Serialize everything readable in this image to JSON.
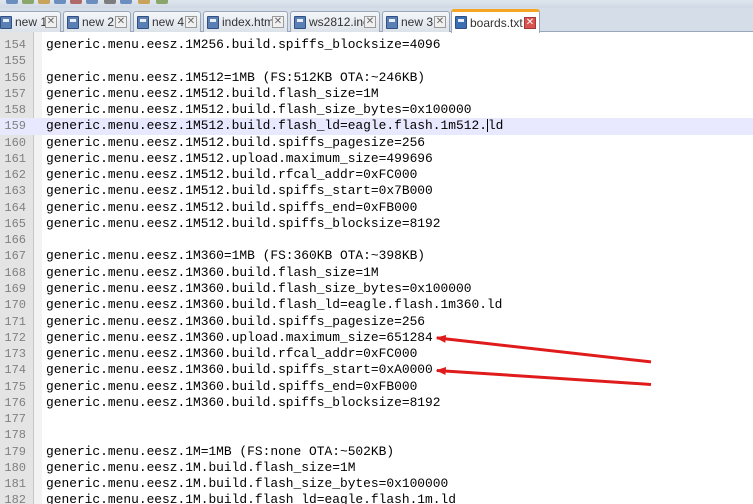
{
  "tabs": [
    {
      "label": "new 1",
      "active": false
    },
    {
      "label": "new 2",
      "active": false
    },
    {
      "label": "new 4",
      "active": false
    },
    {
      "label": "index.html",
      "active": false
    },
    {
      "label": "ws2812.ino",
      "active": false
    },
    {
      "label": "new 3",
      "active": false
    },
    {
      "label": "boards.txt",
      "active": true
    }
  ],
  "editor": {
    "current_line": "159",
    "lines": [
      {
        "num": "154",
        "text": "generic.menu.eesz.1M256.build.spiffs_blocksize=4096"
      },
      {
        "num": "155",
        "text": ""
      },
      {
        "num": "156",
        "text": "generic.menu.eesz.1M512=1MB (FS:512KB OTA:~246KB)"
      },
      {
        "num": "157",
        "text": "generic.menu.eesz.1M512.build.flash_size=1M"
      },
      {
        "num": "158",
        "text": "generic.menu.eesz.1M512.build.flash_size_bytes=0x100000"
      },
      {
        "num": "159",
        "text": "generic.menu.eesz.1M512.build.flash_ld=eagle.flash.1m512.ld"
      },
      {
        "num": "160",
        "text": "generic.menu.eesz.1M512.build.spiffs_pagesize=256"
      },
      {
        "num": "161",
        "text": "generic.menu.eesz.1M512.upload.maximum_size=499696"
      },
      {
        "num": "162",
        "text": "generic.menu.eesz.1M512.build.rfcal_addr=0xFC000"
      },
      {
        "num": "163",
        "text": "generic.menu.eesz.1M512.build.spiffs_start=0x7B000"
      },
      {
        "num": "164",
        "text": "generic.menu.eesz.1M512.build.spiffs_end=0xFB000"
      },
      {
        "num": "165",
        "text": "generic.menu.eesz.1M512.build.spiffs_blocksize=8192"
      },
      {
        "num": "166",
        "text": ""
      },
      {
        "num": "167",
        "text": "generic.menu.eesz.1M360=1MB (FS:360KB OTA:~398KB)"
      },
      {
        "num": "168",
        "text": "generic.menu.eesz.1M360.build.flash_size=1M"
      },
      {
        "num": "169",
        "text": "generic.menu.eesz.1M360.build.flash_size_bytes=0x100000"
      },
      {
        "num": "170",
        "text": "generic.menu.eesz.1M360.build.flash_ld=eagle.flash.1m360.ld"
      },
      {
        "num": "171",
        "text": "generic.menu.eesz.1M360.build.spiffs_pagesize=256"
      },
      {
        "num": "172",
        "text": "generic.menu.eesz.1M360.upload.maximum_size=651284"
      },
      {
        "num": "173",
        "text": "generic.menu.eesz.1M360.build.rfcal_addr=0xFC000"
      },
      {
        "num": "174",
        "text": "generic.menu.eesz.1M360.build.spiffs_start=0xA0000"
      },
      {
        "num": "175",
        "text": "generic.menu.eesz.1M360.build.spiffs_end=0xFB000"
      },
      {
        "num": "176",
        "text": "generic.menu.eesz.1M360.build.spiffs_blocksize=8192"
      },
      {
        "num": "177",
        "text": ""
      },
      {
        "num": "178",
        "text": ""
      },
      {
        "num": "179",
        "text": "generic.menu.eesz.1M=1MB (FS:none OTA:~502KB)"
      },
      {
        "num": "180",
        "text": "generic.menu.eesz.1M.build.flash_size=1M"
      },
      {
        "num": "181",
        "text": "generic.menu.eesz.1M.build.flash_size_bytes=0x100000"
      },
      {
        "num": "182",
        "text": "generic.menu.eesz.1M.build.flash_ld=eagle.flash.1m.ld"
      }
    ]
  },
  "annotations": {
    "arrow_color": "#e01b1b",
    "arrows": [
      {
        "points_to_line": "172"
      },
      {
        "points_to_line": "174"
      }
    ]
  },
  "colors": {
    "current_line_bg": "#e8e8ff",
    "gutter_bg": "#e4e4e4",
    "line_number": "#808080",
    "active_tab_accent": "#f5a623"
  }
}
